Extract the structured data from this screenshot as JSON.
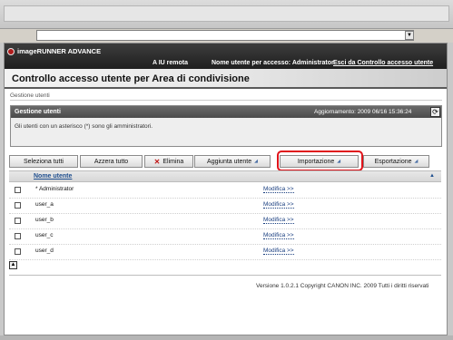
{
  "window": {
    "address_value": ""
  },
  "header": {
    "brand": "imageRUNNER ADVANCE",
    "remote_ui": "A IU remota",
    "user_info": "Nome utente per accesso: Administrator",
    "logout": "Esci da Controllo accesso utente"
  },
  "page": {
    "title": "Controllo accesso utente per Area di condivisione",
    "breadcrumb": "Gestione utenti"
  },
  "panel": {
    "title": "Gestione utenti",
    "updated": "Aggiornamento: 2009 06/16 15:36:24",
    "note": "Gli utenti con un asterisco (*) sono gli amministratori."
  },
  "toolbar": {
    "select_all": "Seleziona tutti",
    "clear_all": "Azzera tutto",
    "delete": "Elimina",
    "add_user": "Aggiunta utente",
    "import": "Importazione",
    "export": "Esportazione"
  },
  "table": {
    "column_name": "Nome utente",
    "rows": [
      {
        "name": "* Administrator",
        "edit": "Modifica >>"
      },
      {
        "name": "user_a",
        "edit": "Modifica >>"
      },
      {
        "name": "user_b",
        "edit": "Modifica >>"
      },
      {
        "name": "user_c",
        "edit": "Modifica >>"
      },
      {
        "name": "user_d",
        "edit": "Modifica >>"
      }
    ]
  },
  "footer": {
    "copyright": "Versione 1.0.2.1 Copyright CANON INC. 2009 Tutti i diritti riservati"
  },
  "icons": {
    "logo": "canon-logo-icon",
    "refresh": "refresh-icon",
    "delete": "x-icon",
    "dropdown": "chevron-down-icon"
  },
  "colors": {
    "header": "#2b2b2b",
    "accent_ring": "#e0131a",
    "link": "#1a3f80"
  }
}
